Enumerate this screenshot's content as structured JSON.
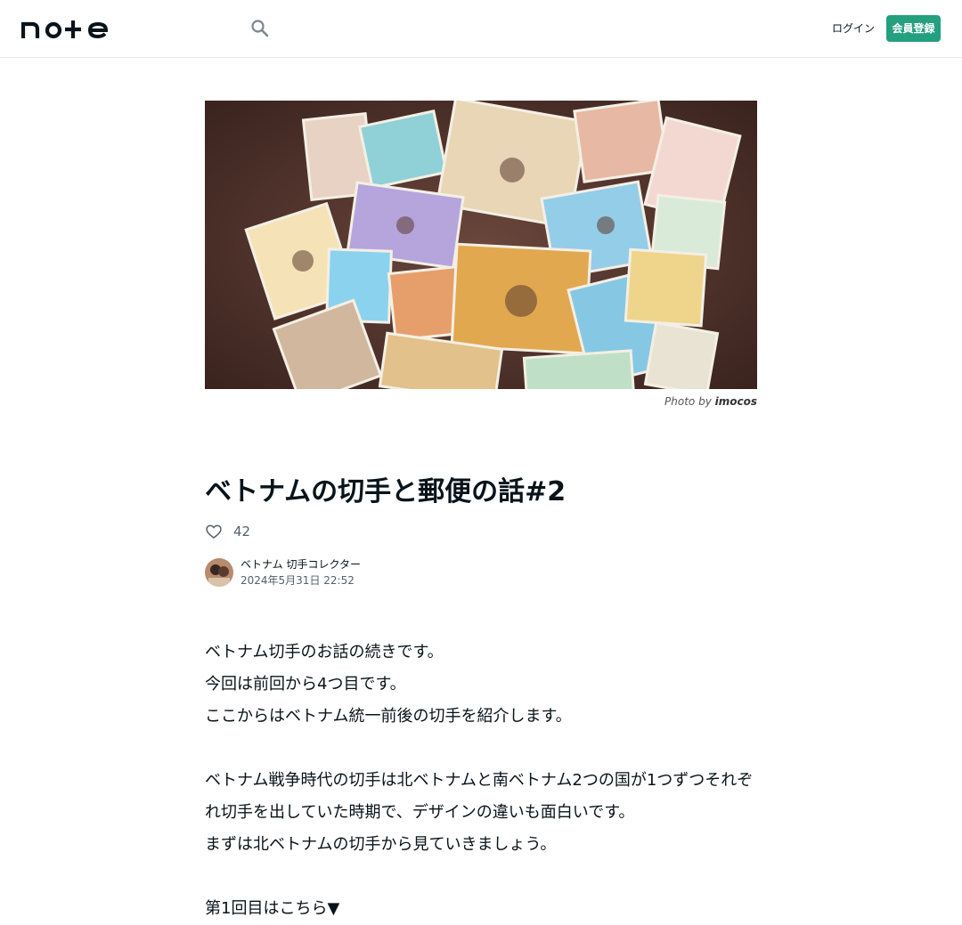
{
  "header": {
    "brand": "note",
    "login_label": "ログイン",
    "signup_label": "会員登録"
  },
  "hero": {
    "caption_prefix": "Photo by",
    "caption_author": "imocos"
  },
  "article": {
    "title": "ベトナムの切手と郵便の話#2",
    "like_count": "42",
    "author_name": "ベトナム 切手コレクター",
    "date": "2024年5月31日 22:52",
    "paragraphs": [
      "ベトナム切手のお話の続きです。",
      "今回は前回から4つ目です。",
      "ここからはベトナム統一前後の切手を紹介します。",
      "",
      "ベトナム戦争時代の切手は北ベトナムと南ベトナム2つの国が1つずつそれぞれ切手を出していた時期で、デザインの違いも面白いです。",
      "まずは北ベトナムの切手から見ていきましょう。",
      "",
      "第1回目はこちら▼"
    ]
  },
  "colors": {
    "accent": "#249f80",
    "text": "#08131a",
    "muted": "#55606a"
  },
  "icons": {
    "search": "search-icon",
    "like": "heart-icon"
  }
}
